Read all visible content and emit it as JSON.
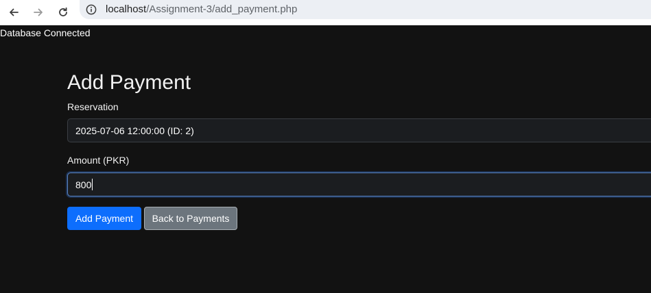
{
  "browser": {
    "url_host": "localhost",
    "url_path": "/Assignment-3/add_payment.php",
    "icons": {
      "back": "arrow-left-icon",
      "forward": "arrow-right-icon",
      "reload": "reload-icon",
      "site_info": "info-circle-icon"
    }
  },
  "page": {
    "status": "Database Connected",
    "title": "Add Payment",
    "reservation": {
      "label": "Reservation",
      "selected": "2025-07-06 12:00:00 (ID: 2)"
    },
    "amount": {
      "label": "Amount (PKR)",
      "value": "800"
    },
    "buttons": {
      "submit": "Add Payment",
      "back": "Back to Payments"
    }
  },
  "colors": {
    "background": "#121212",
    "primary": "#0d6efd",
    "secondary": "#6c757d"
  }
}
